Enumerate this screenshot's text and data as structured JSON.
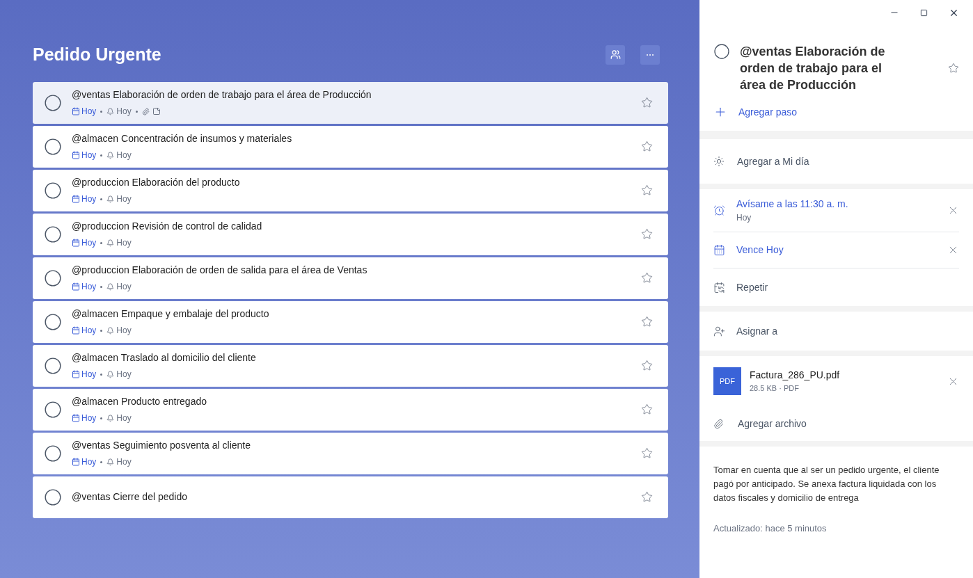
{
  "list": {
    "title": "Pedido Urgente",
    "tasks": [
      {
        "title": "@ventas Elaboración de orden de trabajo para el área de Producción",
        "due": "Hoy",
        "reminder": "Hoy",
        "has_attachment": true,
        "has_note": true,
        "selected": true,
        "starred": false,
        "completed": false
      },
      {
        "title": "@almacen Concentración de insumos y materiales",
        "due": "Hoy",
        "reminder": "Hoy",
        "has_attachment": false,
        "has_note": false,
        "selected": false,
        "starred": false,
        "completed": false
      },
      {
        "title": "@produccion Elaboración del producto",
        "due": "Hoy",
        "reminder": "Hoy",
        "has_attachment": false,
        "has_note": false,
        "selected": false,
        "starred": false,
        "completed": false
      },
      {
        "title": "@produccion Revisión de control de calidad",
        "due": "Hoy",
        "reminder": "Hoy",
        "has_attachment": false,
        "has_note": false,
        "selected": false,
        "starred": false,
        "completed": false
      },
      {
        "title": "@produccion Elaboración de orden de salida para el área de Ventas",
        "due": "Hoy",
        "reminder": "Hoy",
        "has_attachment": false,
        "has_note": false,
        "selected": false,
        "starred": false,
        "completed": false
      },
      {
        "title": "@almacen Empaque y embalaje del producto",
        "due": "Hoy",
        "reminder": "Hoy",
        "has_attachment": false,
        "has_note": false,
        "selected": false,
        "starred": false,
        "completed": false
      },
      {
        "title": "@almacen Traslado al domicilio del cliente",
        "due": "Hoy",
        "reminder": "Hoy",
        "has_attachment": false,
        "has_note": false,
        "selected": false,
        "starred": false,
        "completed": false
      },
      {
        "title": "@almacen Producto entregado",
        "due": "Hoy",
        "reminder": "Hoy",
        "has_attachment": false,
        "has_note": false,
        "selected": false,
        "starred": false,
        "completed": false
      },
      {
        "title": "@ventas Seguimiento posventa al cliente",
        "due": "Hoy",
        "reminder": "Hoy",
        "has_attachment": false,
        "has_note": false,
        "selected": false,
        "starred": false,
        "completed": false
      },
      {
        "title": "@ventas Cierre del pedido",
        "has_attachment": false,
        "has_note": false,
        "selected": false,
        "starred": false,
        "completed": false
      }
    ]
  },
  "detail": {
    "title": "@ventas Elaboración de orden de trabajo para el área de Producción",
    "completed": false,
    "starred": false,
    "add_step": "Agregar paso",
    "my_day": "Agregar a Mi día",
    "reminder": {
      "label": "Avísame a las 11:30 a. m.",
      "sub": "Hoy"
    },
    "due": {
      "label": "Vence Hoy"
    },
    "repeat": "Repetir",
    "assign": "Asignar a",
    "file": {
      "badge": "PDF",
      "name": "Factura_286_PU.pdf",
      "meta": "28.5 KB · PDF"
    },
    "add_file": "Agregar archivo",
    "note": "Tomar en cuenta que al ser un pedido urgente, el cliente pagó por anticipado. Se anexa factura liquidada con los datos fiscales y domicilio de entrega",
    "updated": "Actualizado: hace 5 minutos"
  }
}
